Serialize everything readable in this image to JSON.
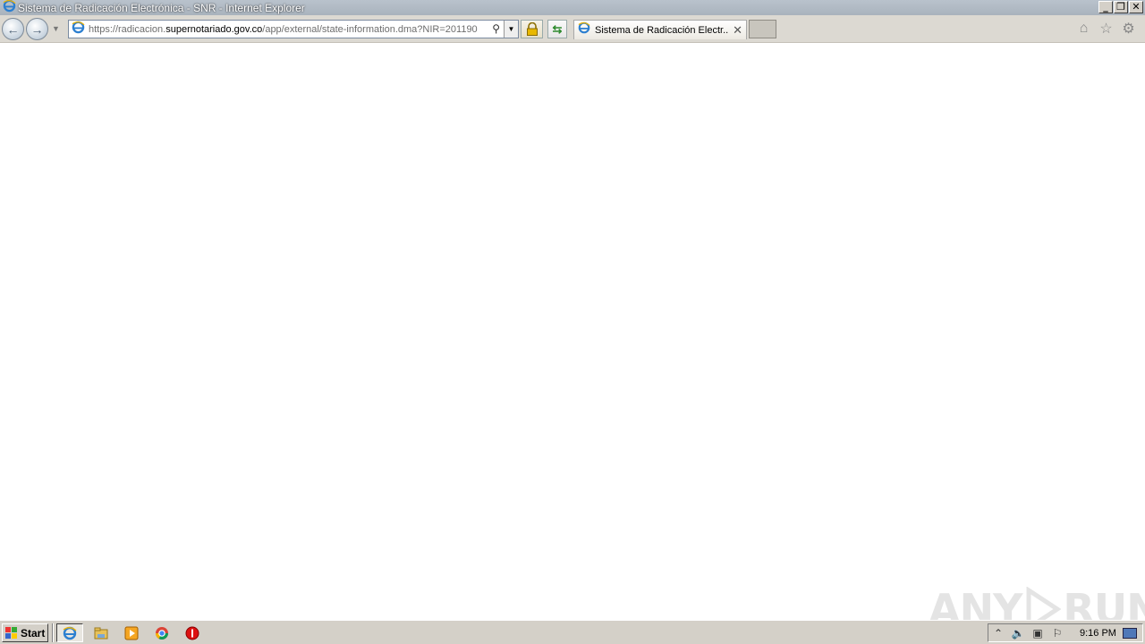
{
  "window": {
    "title": "Sistema de Radicación Electrónica - SNR - Internet Explorer",
    "controls": [
      "minimize",
      "restore",
      "close"
    ]
  },
  "navbar": {
    "url_prefix": "https://radicacion.",
    "url_domain": "supernotariado.gov.co",
    "url_path": "/app/external/state-information.dma?NIR=201190",
    "tab_title": "Sistema de Radicación Electr...",
    "icons": [
      "back-icon",
      "forward-icon",
      "search-icon",
      "lock-icon",
      "refresh-icon",
      "home-icon",
      "favorites-icon",
      "tools-icon"
    ]
  },
  "watermark": {
    "text_left": "ANY",
    "text_right": "RUN"
  },
  "taskbar": {
    "start_label": "Start",
    "apps": [
      "internet-explorer-icon",
      "file-explorer-icon",
      "media-player-icon",
      "chrome-icon",
      "stop-icon"
    ],
    "clock": "9:16 PM"
  },
  "colors": {
    "titlebar": "#b9c2cc",
    "taskbar": "#d4d0c8",
    "ie_blue": "#2c7fd0"
  }
}
